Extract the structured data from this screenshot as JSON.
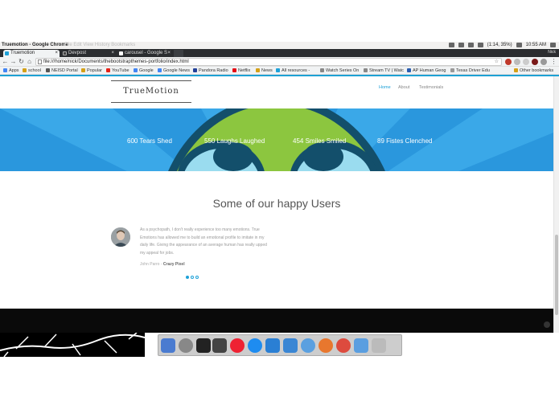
{
  "os_bar": {
    "window_title": "Truemotion - Google Chrome",
    "ghost_menu": "File  Edit  View  History  Bookmarks",
    "battery": "(1:14, 35%)",
    "clock": "10:55 AM"
  },
  "tabs": [
    {
      "label": "Truemotion",
      "active": true
    },
    {
      "label": "Devpost",
      "active": false
    },
    {
      "label": "carousel - Google S",
      "active": false
    }
  ],
  "profile": "Nick",
  "address_bar": {
    "url": "file:///home/nick/Documents/thebootstrapthemes-portfolio/index.html"
  },
  "bookmarks": [
    "Apps",
    "school",
    "NEISD Portal",
    "Popular",
    "YouTube",
    "Google",
    "Google News",
    "Pandora Radio",
    "Netflix",
    "News",
    "All resources -",
    "Watch Series On",
    "Stream TV | Watc",
    "AP Human Geog",
    "Texas Driver Edu",
    "Other bookmarks"
  ],
  "site": {
    "brand": "TrueMotion",
    "nav": [
      {
        "label": "Home",
        "active": true
      },
      {
        "label": "About",
        "active": false
      },
      {
        "label": "Testimonials",
        "active": false
      }
    ],
    "stats": [
      "600 Tears Shed",
      "550 Laughs Laughed",
      "454 Smiles Smiled",
      "89 Fistes Clenched"
    ],
    "users_title": "Some of our happy Users",
    "testimonial": {
      "quote": "As a psychopath, I don't really experience too many emotions. True Emotions has allowed me to build an emotional profile to imitate in my daily life. Giving the appearance of an average human has really upped my appeal for jobs.",
      "author": "John Parro -",
      "company": "Crazy Pixel"
    }
  },
  "colors": {
    "accent": "#1ea1d8",
    "hero_blue": "#2a97dd",
    "creature_green": "#8cc63f",
    "footer": "#0a0a0a"
  }
}
